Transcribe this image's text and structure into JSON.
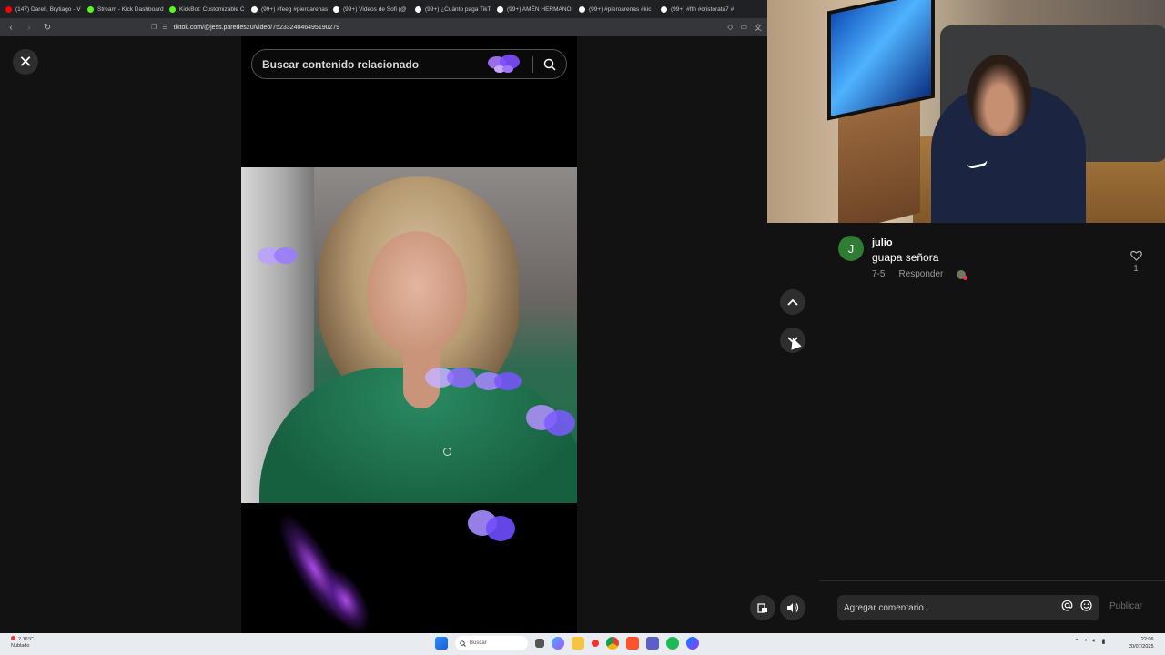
{
  "browser": {
    "tabs": [
      {
        "label": "(147) Darell, Brytiago - V",
        "color": "#ff0000"
      },
      {
        "label": "Stream - Kick Dashboard",
        "color": "#53fc18"
      },
      {
        "label": "KickBot: Customizable C",
        "color": "#53fc18"
      },
      {
        "label": "(99+) #feeg #pieroarenas",
        "color": "#ffffff"
      },
      {
        "label": "(99+) Videos de Sofi (@",
        "color": "#ffffff"
      },
      {
        "label": "(99+) ¿Cuánto paga TikT",
        "color": "#ffffff"
      },
      {
        "label": "(99+) AMÉN HERMANO",
        "color": "#ffffff"
      },
      {
        "label": "(99+) #pieroarenas #kic",
        "color": "#ffffff"
      },
      {
        "label": "(99+) #fth #cristorata7 #",
        "color": "#ffffff"
      }
    ],
    "url": "tiktok.com/@jess.paredes20/video/7523324046495190279"
  },
  "viewer": {
    "search_placeholder": "Buscar contenido relacionado"
  },
  "comments": {
    "items": [
      {
        "avatar_letter": "J",
        "username": "julio",
        "text": "guapa señora",
        "date": "7-5",
        "reply_label": "Responder",
        "likes": "1"
      }
    ],
    "input_placeholder": "Agregar comentario...",
    "publish_label": "Publicar"
  },
  "taskbar": {
    "temperature": "16°C",
    "weather": "Nublado",
    "notification_count": "2",
    "search_label": "Buscar",
    "time": "22:06",
    "date": "20/07/2025"
  },
  "colors": {
    "accent_avatar": "#2e7d32",
    "butterfly": "#a778ff",
    "tiktok_bg": "#121212"
  }
}
